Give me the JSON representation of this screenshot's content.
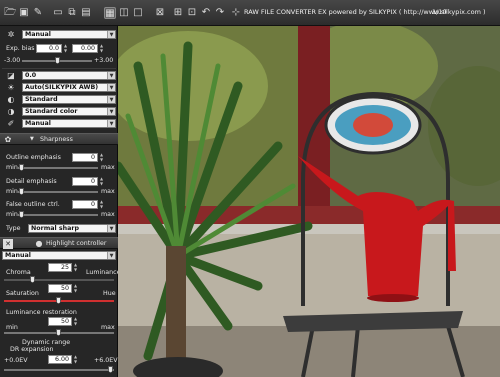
{
  "toolbar": {
    "title": "RAW FILE CONVERTER EX powered by SILKYPIX ( http://www.silkypix.com )",
    "counter": "1/10",
    "icons": [
      "open-folder-icon",
      "save-icon",
      "develop-icon",
      "browse-icon",
      "folder-view-icon",
      "single-view-icon",
      "grid-view-icon",
      "compare-view-icon",
      "full-view-icon",
      "grid-guide-icon",
      "crop-icon",
      "mark-icon",
      "rotate-left-icon",
      "rotate-right-icon",
      "fit-icon",
      "zoom-icon",
      "prev-icon",
      "next-icon"
    ]
  },
  "exposure": {
    "mode": "Manual",
    "bias_label": "Exp. bias",
    "bias_value1": "0.0",
    "bias_value2": "0.00",
    "min_label": "-3.00",
    "max_label": "+3.00",
    "bias_level": 0.5
  },
  "rows": {
    "tone_value": "0.0",
    "white_balance": "Auto(SILKYPIX AWB)",
    "tone_curve": "Standard",
    "color": "Standard color",
    "sharp_mode": "Manual"
  },
  "sharpness": {
    "header": "Sharpness",
    "outline_label": "Outline emphasis",
    "outline_value": "0",
    "detail_label": "Detail emphasis",
    "detail_value": "0",
    "false_outline_label": "False outline ctrl.",
    "false_outline_value": "0",
    "min": "min",
    "max": "max",
    "type_label": "Type",
    "type_value": "Normal sharp"
  },
  "highlight": {
    "header": "Highlight controller",
    "mode": "Manual",
    "chroma_label": "Chroma",
    "chroma_value": "25",
    "luminance_label": "Luminance",
    "saturation_label": "Saturation",
    "saturation_value": "50",
    "hue_label": "Hue",
    "restoration_label": "Luminance restoration",
    "restoration_value": "50",
    "min": "min",
    "max": "max",
    "dr_label": "Dynamic range",
    "dr_sub": "DR expansion",
    "dr_min": "+0.0EV",
    "dr_value": "6.00",
    "dr_max": "+6.0EV"
  },
  "colors": {
    "panel_bg": "#262626",
    "watering_can": "#c8181c",
    "accent_line": "#d03030"
  }
}
